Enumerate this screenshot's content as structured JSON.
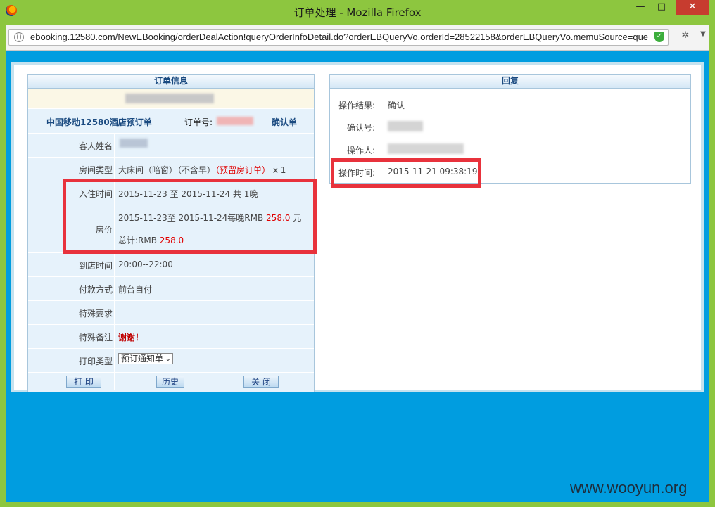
{
  "window": {
    "title": "订单处理 - Mozilla Firefox",
    "minimize": "—",
    "maximize": "□",
    "close": "✕"
  },
  "addressbar": {
    "url": "ebooking.12580.com/NewEBooking/orderDealAction!queryOrderInfoDetail.do?orderEBQueryVo.orderId=28522158&orderEBQueryVo.memuSource=que"
  },
  "order": {
    "header": "订单信息",
    "company": "中国移动12580酒店预订单",
    "order_no_label": "订单号:",
    "confirm_label": "确认单",
    "rows": {
      "guest_label": "客人姓名",
      "room_type_label": "房间类型",
      "room_type_value": "大床间（暗窗）（不含早）",
      "room_type_reserved": "（预留房订单）",
      "room_count": "x 1",
      "checkin_label": "入住时间",
      "checkin_value": "2015-11-23 至 2015-11-24 共 1晚",
      "price_label": "房价",
      "price_line_prefix": "2015-11-23至 2015-11-24每晚RMB",
      "price_amount": "258.0",
      "price_unit": "元",
      "total_prefix": "总计:RMB",
      "total_amount": "258.0",
      "arrive_label": "到店时间",
      "arrive_value": "20:00--22:00",
      "payment_label": "付款方式",
      "payment_value": "前台自付",
      "special_req_label": "特殊要求",
      "special_note_label": "特殊备注",
      "special_note_value": "谢谢！",
      "print_type_label": "打印类型",
      "print_type_selected": "预订通知单"
    },
    "buttons": {
      "print": "打 印",
      "history": "历史",
      "close": "关 闭"
    }
  },
  "reply": {
    "header": "回复",
    "result_label": "操作结果:",
    "result_value": "确认",
    "confirm_no_label": "确认号:",
    "operator_label": "操作人:",
    "op_time_label": "操作时间:",
    "op_time_value": "2015-11-21 09:38:19"
  },
  "watermark": "www.wooyun.org"
}
